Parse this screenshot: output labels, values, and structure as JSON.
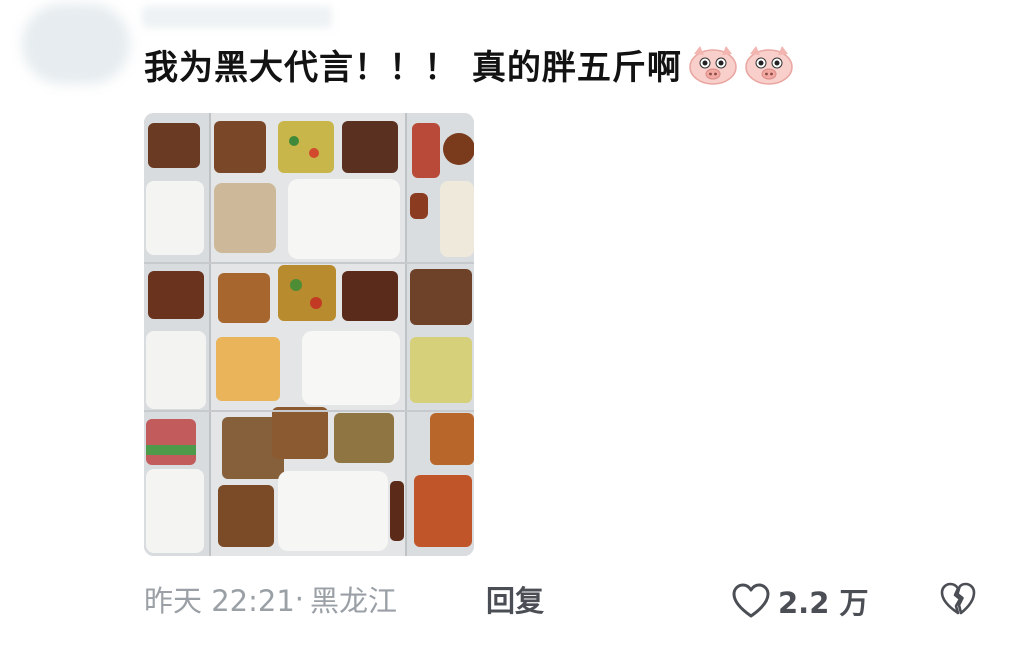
{
  "comment": {
    "text": "我为黑大代言！！！ 真的胖五斤啊",
    "emojis": [
      "pig-face-icon",
      "pig-face-icon"
    ],
    "image_description_icon": "food-photo"
  },
  "meta": {
    "time": "昨天 22:21",
    "separator": "·",
    "location": "黑龙江",
    "reply_label": "回复"
  },
  "actions": {
    "like_count": "2.2 万",
    "like_icon": "heart-outline-icon",
    "dislike_icon": "broken-heart-icon"
  },
  "colors": {
    "text": "#121212",
    "meta": "#9aa0a6",
    "action": "#4b4f55",
    "pig": "#f7c6c2"
  }
}
